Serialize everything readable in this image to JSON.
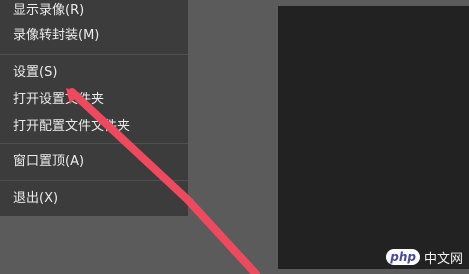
{
  "menu": {
    "items": [
      {
        "label": "显示录像(R)"
      },
      {
        "label": "录像转封装(M)"
      },
      {
        "label": "设置(S)"
      },
      {
        "label": "打开设置文件夹"
      },
      {
        "label": "打开配置文件文件夹"
      },
      {
        "label": "窗口置顶(A)"
      },
      {
        "label": "退出(X)"
      }
    ]
  },
  "annotation": {
    "arrow_color": "#ee4a5f"
  },
  "watermark": {
    "badge": "php",
    "text": "中文网"
  },
  "colors": {
    "menu_bg": "#3c3c3c",
    "background": "#5b5b5b",
    "panel": "#222222"
  }
}
